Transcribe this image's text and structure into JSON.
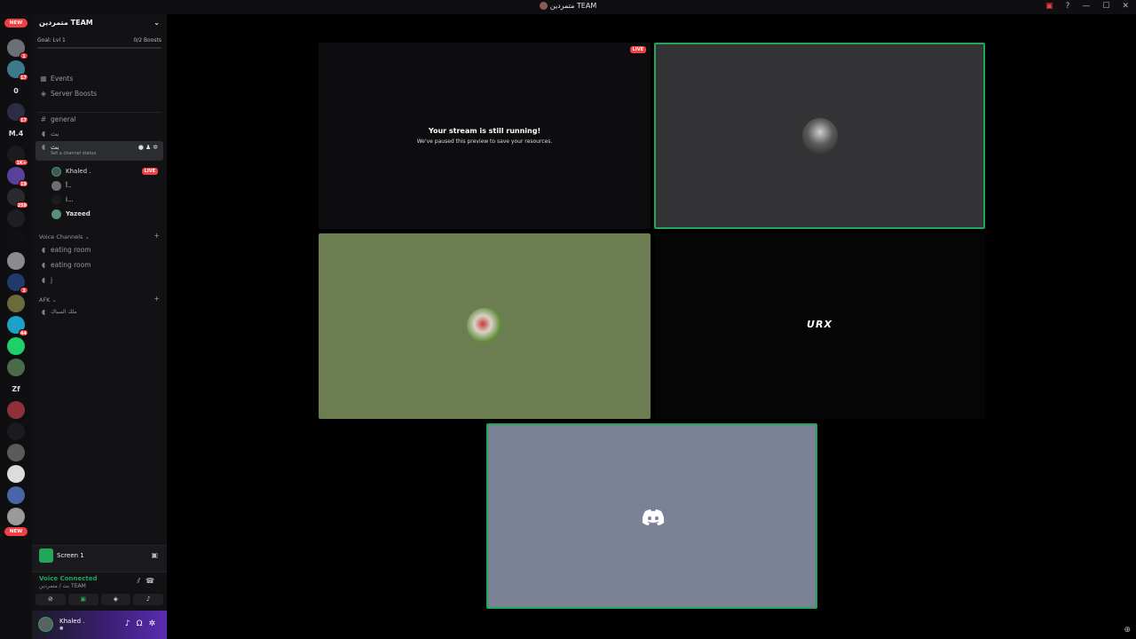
{
  "window": {
    "title": "متمردين TEAM"
  },
  "rail": {
    "new_label": "NEW",
    "servers": [
      {
        "initials": "",
        "badge": "1",
        "color": "#6b6f78"
      },
      {
        "initials": "",
        "badge": "17",
        "color": "#3f7a8c"
      },
      {
        "initials": "0",
        "badge": "",
        "color": "#0f0f11"
      },
      {
        "initials": "",
        "badge": "17",
        "color": "#2b2d45"
      },
      {
        "initials": "M.4",
        "badge": "",
        "color": "#0f0f11"
      },
      {
        "initials": "",
        "badge": "1K+",
        "color": "#1b1b1e"
      },
      {
        "initials": "",
        "badge": "19",
        "color": "#5b3f9a"
      },
      {
        "initials": "",
        "badge": "259",
        "color": "#2a2a30"
      },
      {
        "initials": "",
        "badge": "",
        "color": "#1e1f22"
      },
      {
        "initials": "",
        "badge": "",
        "color": "#111113"
      },
      {
        "initials": "",
        "badge": "",
        "color": "#8a8a8f"
      },
      {
        "initials": "",
        "badge": "3",
        "color": "#1f3a6b"
      },
      {
        "initials": "",
        "badge": "",
        "color": "#6b6a3a"
      },
      {
        "initials": "",
        "badge": "44",
        "color": "#1da1c7"
      },
      {
        "initials": "",
        "badge": "",
        "color": "#1ecf6a"
      },
      {
        "initials": "",
        "badge": "",
        "color": "#4a6b4a"
      },
      {
        "initials": "Zf",
        "badge": "",
        "color": "#0f0f11"
      },
      {
        "initials": "",
        "badge": "",
        "color": "#8f2f3a"
      },
      {
        "initials": "",
        "badge": "",
        "color": "#1b1b1e"
      },
      {
        "initials": "",
        "badge": "",
        "color": "#5a5a5a"
      },
      {
        "initials": "",
        "badge": "",
        "color": "#dcdcdc"
      },
      {
        "initials": "",
        "badge": "",
        "color": "#4a64a8"
      },
      {
        "initials": "",
        "badge": "",
        "color": "#9a9a9a"
      }
    ]
  },
  "server": {
    "name": "متمردين TEAM",
    "boost_goal": "Goal: Lvl 1",
    "boost_count": "0/2 Boosts",
    "boost_progress": 0
  },
  "nav": {
    "events": "Events",
    "boosts": "Server Boosts"
  },
  "channels": {
    "general": "general",
    "voice1": "بث",
    "active": "بث",
    "active_status": "Set a channel status",
    "members": [
      {
        "name": "Khaled .",
        "live": true
      },
      {
        "name": "آ..",
        "live": false
      },
      {
        "name": "i...",
        "live": false
      },
      {
        "name": "Yazeed",
        "live": false
      }
    ],
    "live_label": "LIVE",
    "voice_category": "Voice Channels",
    "voice_list": [
      "eating room",
      "eating room",
      "j"
    ],
    "afk_category": "AFK",
    "afk_channel": "ملك السباك"
  },
  "screen_panel": {
    "name": "Screen 1"
  },
  "voice_panel": {
    "title": "Voice Connected",
    "subtitle": "بث / متمردين TEAM"
  },
  "user": {
    "name": "Khaled ."
  },
  "stage": {
    "stream_title": "Your stream is still running!",
    "stream_sub": "We've paused this preview to save your resources.",
    "live_label": "LIVE",
    "logo_text": "URX"
  }
}
